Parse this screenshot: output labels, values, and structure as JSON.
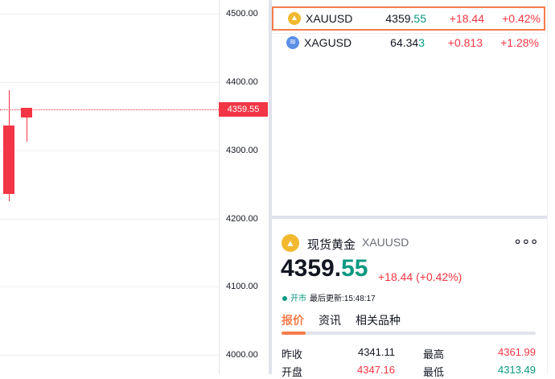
{
  "price_axis": {
    "ticks": [
      "4500.00",
      "4400.00",
      "4300.00",
      "4200.00",
      "4100.00",
      "4000.00"
    ],
    "current_price_tag": "4359.55"
  },
  "chart_data": {
    "type": "candlestick",
    "candles": [
      {
        "open": 4336,
        "high": 4388,
        "low": 4225,
        "close": 4236
      },
      {
        "open": 4362,
        "high": 4362,
        "low": 4313,
        "close": 4348
      }
    ],
    "ylim": [
      4000,
      4500
    ]
  },
  "watchlist": {
    "rows": [
      {
        "symbol": "XAUUSD",
        "last_main": "4359.",
        "last_hl": "55",
        "change": "+18.44",
        "change_pct": "+0.42%",
        "icon_color": "#f2b92f"
      },
      {
        "symbol": "XAGUSD",
        "last_main": "64.34",
        "last_hl": "3",
        "change": "+0.813",
        "change_pct": "+1.28%",
        "icon_color": "#5b8ee6"
      }
    ]
  },
  "details": {
    "name": "现货黄金",
    "symbol": "XAUUSD",
    "more": "∘∘∘",
    "price_main": "4359.",
    "price_hl": "55",
    "change": "+18.44 (+0.42%)",
    "market_status": "开市",
    "last_update": "最后更新:15:48:17",
    "tabs": [
      "报价",
      "资讯",
      "相关品种"
    ],
    "stats": [
      {
        "label": "昨收",
        "value": "4341.11",
        "label2": "最高",
        "value2": "4361.99"
      },
      {
        "label": "开盘",
        "value": "4347.16",
        "label2": "最低",
        "value2": "4313.49"
      }
    ]
  },
  "colors": {
    "up": "#089981",
    "down": "#f23645",
    "accent": "#f57c4c"
  }
}
